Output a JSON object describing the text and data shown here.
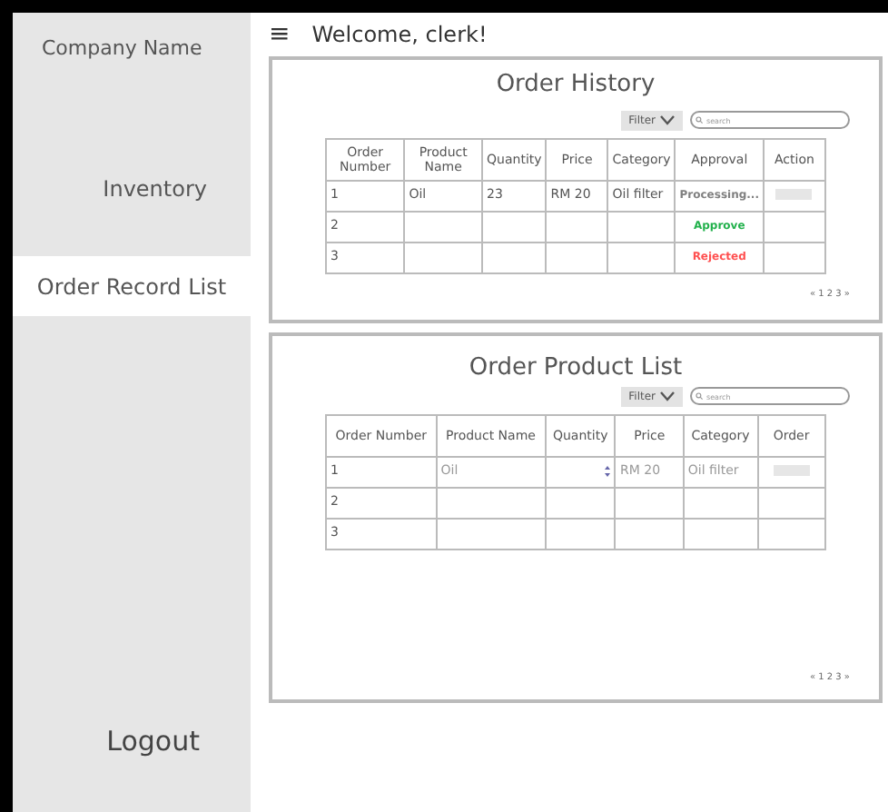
{
  "sidebar": {
    "company": "Company Name",
    "items": [
      {
        "label": "Inventory",
        "selected": false
      },
      {
        "label": "Order Record List",
        "selected": true
      }
    ],
    "logout": "Logout"
  },
  "header": {
    "menu_icon": "≡",
    "greeting": "Welcome, clerk!"
  },
  "order_history": {
    "title": "Order History",
    "filter": "Filter",
    "search": {
      "placeholder": "search"
    },
    "columns": [
      "Order Number",
      "Product Name",
      "Quantity",
      "Price",
      "Category",
      "Approval",
      "Action"
    ],
    "rows": [
      {
        "order_number": "1",
        "product_name": "Oil",
        "quantity": "23",
        "price": "RM 20",
        "category": "Oil filter",
        "approval": {
          "text": "Processing...",
          "color": "#808080"
        },
        "action_button": true
      },
      {
        "order_number": "2",
        "approval": {
          "text": "Approve",
          "color": "#22b14c"
        },
        "action_button": false
      },
      {
        "order_number": "3",
        "approval": {
          "text": "Rejected",
          "color": "#ff5050"
        },
        "action_button": false
      }
    ],
    "pagination": "« 1 2 3 »"
  },
  "order_product_list": {
    "title": "Order Product List",
    "filter": "Filter",
    "search": {
      "placeholder": "search"
    },
    "columns": [
      "Order Number",
      "Product Name",
      "Quantity",
      "Price",
      "Category",
      "Order"
    ],
    "rows": [
      {
        "order_number": "1",
        "product_name": "Oil",
        "quantity_spinner": true,
        "price": "RM 20",
        "category": "Oil filter",
        "order_button": true
      },
      {
        "order_number": "2",
        "quantity_spinner": false,
        "order_button": false
      },
      {
        "order_number": "3",
        "quantity_spinner": false,
        "order_button": false
      }
    ],
    "pagination": "« 1 2 3 »"
  }
}
